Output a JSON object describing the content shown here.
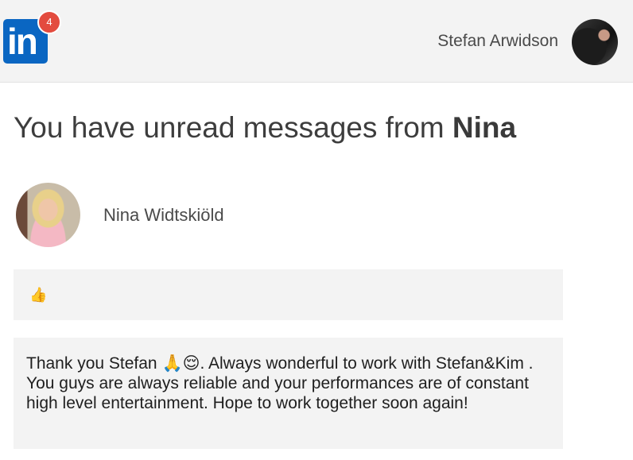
{
  "header": {
    "logo_text": "in",
    "notification_count": "4",
    "user_name": "Stefan Arwidson",
    "brand_color": "#0a66c2",
    "badge_color": "#e34b3e"
  },
  "main": {
    "headline_prefix": "You have unread messages from ",
    "headline_name": "Nina",
    "sender_name": "Nina Widtskiöld",
    "messages": [
      {
        "text": "👍"
      },
      {
        "text": "Thank you Stefan 🙏😌. Always wonderful to work with Stefan&Kim . You guys are always reliable and your performances are of constant high level entertainment. Hope to work together soon again!"
      }
    ]
  }
}
